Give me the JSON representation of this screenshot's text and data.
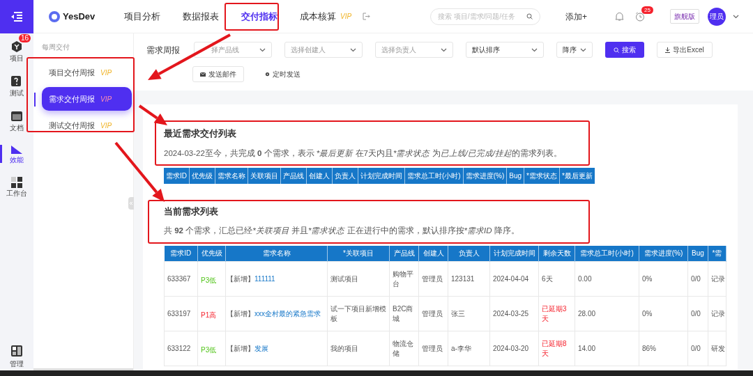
{
  "app": {
    "name": "YesDev"
  },
  "rail": [
    {
      "label": "项目",
      "badge": "16",
      "selected": false
    },
    {
      "label": "测试",
      "selected": false
    },
    {
      "label": "文档",
      "selected": false
    },
    {
      "label": "效能",
      "selected": true
    },
    {
      "label": "工作台",
      "selected": false
    }
  ],
  "rail_bottom": {
    "label": "管理"
  },
  "tabs": [
    {
      "label": "项目分析",
      "selected": false
    },
    {
      "label": "数据报表",
      "selected": false
    },
    {
      "label": "交付指标",
      "selected": true
    },
    {
      "label": "成本核算",
      "selected": false,
      "vip": "VIP"
    }
  ],
  "search": {
    "placeholder": "搜索 项目/需求/问题/任务"
  },
  "add_button": "添加+",
  "reminder_badge": "25",
  "edition": "旗舰版",
  "avatar": "理员",
  "subnav": {
    "heading": "每周交付",
    "items": [
      {
        "label": "项目交付周报",
        "vip": "VIP",
        "selected": false
      },
      {
        "label": "需求交付周报",
        "vip": "VIP",
        "selected": true
      },
      {
        "label": "测试交付周报",
        "vip": "VIP",
        "selected": false
      }
    ]
  },
  "filters": {
    "title": "需求周报",
    "selects": [
      {
        "placeholder": "择产品线"
      },
      {
        "placeholder": "选择创建人"
      },
      {
        "placeholder": "选择负责人"
      },
      {
        "value": "默认排序"
      },
      {
        "value": "降序"
      }
    ],
    "search_button": "搜索",
    "export_button": "导出Excel",
    "mail_button": "发送邮件",
    "schedule_button": "定时发送"
  },
  "recent": {
    "title": "最近需求交付列表",
    "description": [
      {
        "text": "2024-03-22至今，共完成 ",
        "kind": "plain"
      },
      {
        "text": "0",
        "kind": "bold"
      },
      {
        "text": " 个需求，表示 ",
        "kind": "plain"
      },
      {
        "text": "*最后更新",
        "kind": "italic"
      },
      {
        "text": " 在7天内且",
        "kind": "plain"
      },
      {
        "text": "*需求状态",
        "kind": "italic"
      },
      {
        "text": " 为",
        "kind": "plain"
      },
      {
        "text": "已上线/已完成/挂起",
        "kind": "italic"
      },
      {
        "text": "的需求列表。",
        "kind": "plain"
      }
    ],
    "columns": [
      "需求ID",
      "优先级",
      "需求名称",
      "关联项目",
      "产品线",
      "创建人",
      "负责人",
      "计划完成时间",
      "需求总工时(小时)",
      "需求进度(%)",
      "Bug",
      "*需求状态",
      "*最后更新"
    ]
  },
  "current": {
    "title": "当前需求列表",
    "description": [
      {
        "text": "共 ",
        "kind": "plain"
      },
      {
        "text": "92",
        "kind": "bold"
      },
      {
        "text": " 个需求，汇总已经",
        "kind": "plain"
      },
      {
        "text": "*关联项目",
        "kind": "italic"
      },
      {
        "text": " 并且",
        "kind": "plain"
      },
      {
        "text": "*需求状态",
        "kind": "italic"
      },
      {
        "text": " 正在进行中的需求，默认排序按",
        "kind": "plain"
      },
      {
        "text": "*需求ID",
        "kind": "italic"
      },
      {
        "text": " 降序。",
        "kind": "plain"
      }
    ],
    "columns": [
      "需求ID",
      "优先级",
      "需求名称",
      "*关联项目",
      "产品线",
      "创建人",
      "负责人",
      "计划完成时间",
      "剩余天数",
      "需求总工时(小时)",
      "需求进度(%)",
      "Bug",
      "*需"
    ],
    "rows": [
      {
        "id": "633367",
        "priority": {
          "text": "P3低",
          "color": "#52c41a"
        },
        "tag": "【新增】",
        "name": "111111",
        "project": "测试项目",
        "product": "购物平台",
        "creator": "管理员",
        "owner": "123131",
        "due": "2024-04-04",
        "remaining": {
          "text": "6天",
          "overdue": false
        },
        "hours": "0.00",
        "progress": "0%",
        "bug": "0/0",
        "status": "记录"
      },
      {
        "id": "633197",
        "priority": {
          "text": "P1高",
          "color": "#f5222d"
        },
        "tag": "【新增】",
        "name": "xxx全村最的紧急需求",
        "project": "试一下项目新增模板",
        "product": "B2C商城",
        "creator": "管理员",
        "owner": "张三",
        "due": "2024-03-25",
        "remaining": {
          "text": "已延期3天",
          "overdue": true
        },
        "hours": "28.00",
        "progress": "0%",
        "bug": "0/0",
        "status": "记录"
      },
      {
        "id": "633122",
        "priority": {
          "text": "P3低",
          "color": "#52c41a"
        },
        "tag": "【新增】",
        "name": "发展",
        "project": "我的项目",
        "product": "物流仓储",
        "creator": "管理员",
        "owner": "a-李华",
        "due": "2024-03-20",
        "remaining": {
          "text": "已延期8天",
          "overdue": true
        },
        "hours": "14.00",
        "progress": "86%",
        "bug": "0/0",
        "status": "研发"
      }
    ]
  }
}
